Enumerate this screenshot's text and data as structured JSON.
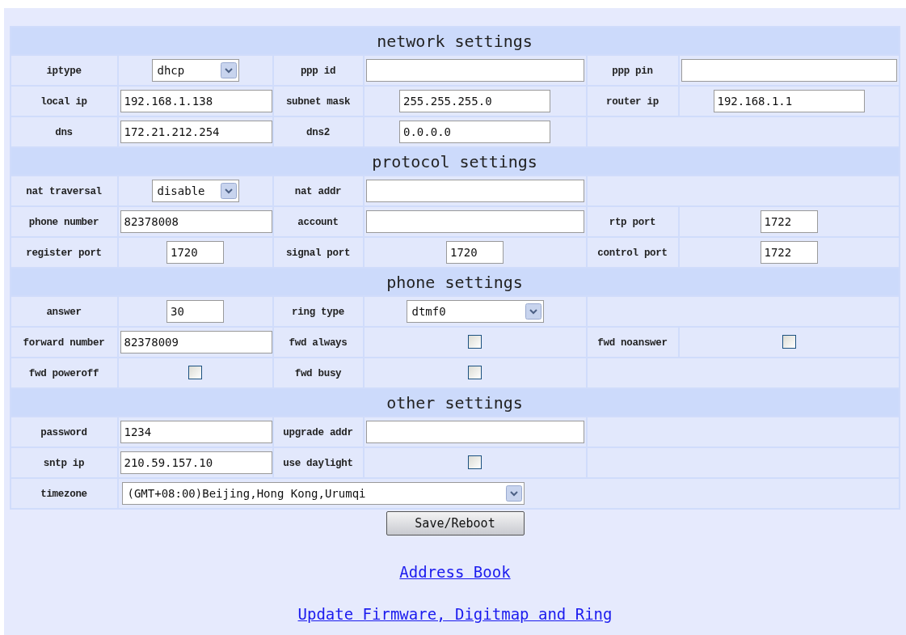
{
  "sections": [
    {
      "title": "network settings",
      "rows": [
        [
          {
            "kind": "label",
            "text": "iptype"
          },
          {
            "kind": "select",
            "value": "dhcp"
          },
          {
            "kind": "label",
            "text": "ppp id"
          },
          {
            "kind": "wide-field"
          },
          {
            "kind": "label",
            "text": "ppp pin"
          },
          {
            "kind": "wide-field"
          }
        ],
        [
          {
            "kind": "label",
            "text": "local ip"
          },
          {
            "kind": "wide-field",
            "value": "192.168.1.138"
          },
          {
            "kind": "label",
            "text": "subnet mask"
          },
          {
            "kind": "field",
            "value": "255.255.255.0"
          },
          {
            "kind": "label",
            "text": "router ip"
          },
          {
            "kind": "field",
            "value": "192.168.1.1"
          }
        ],
        [
          {
            "kind": "label",
            "text": "dns"
          },
          {
            "kind": "wide-field",
            "value": "172.21.212.254"
          },
          {
            "kind": "label",
            "text": "dns2"
          },
          {
            "kind": "field",
            "value": "0.0.0.0"
          },
          {
            "kind": "blank",
            "colspan": 2
          }
        ]
      ]
    },
    {
      "title": "protocol settings",
      "rows": [
        [
          {
            "kind": "label",
            "text": "nat traversal"
          },
          {
            "kind": "select",
            "value": "disable"
          },
          {
            "kind": "label",
            "text": "nat addr"
          },
          {
            "kind": "wide-field"
          },
          {
            "kind": "blank",
            "colspan": 2
          }
        ],
        [
          {
            "kind": "label",
            "text": "phone number"
          },
          {
            "kind": "wide-field",
            "value": "82378008"
          },
          {
            "kind": "label",
            "text": "account"
          },
          {
            "kind": "wide-field"
          },
          {
            "kind": "label",
            "text": "rtp port"
          },
          {
            "kind": "short-field",
            "value": "1722"
          }
        ],
        [
          {
            "kind": "label",
            "text": "register port"
          },
          {
            "kind": "short-field",
            "value": "1720"
          },
          {
            "kind": "label",
            "text": "signal port"
          },
          {
            "kind": "short-field",
            "value": "1720"
          },
          {
            "kind": "label",
            "text": "control port"
          },
          {
            "kind": "short-field",
            "value": "1722"
          }
        ]
      ]
    },
    {
      "title": "phone settings",
      "rows": [
        [
          {
            "kind": "label",
            "text": "answer"
          },
          {
            "kind": "short-field",
            "value": "30"
          },
          {
            "kind": "label",
            "text": "ring type"
          },
          {
            "kind": "wide-select",
            "value": "dtmf0"
          },
          {
            "kind": "blank",
            "colspan": 2
          }
        ],
        [
          {
            "kind": "label",
            "text": "forward number"
          },
          {
            "kind": "wide-field",
            "value": "82378009"
          },
          {
            "kind": "label",
            "text": "fwd always"
          },
          {
            "kind": "checkbox",
            "checked": false
          },
          {
            "kind": "label",
            "text": "fwd noanswer"
          },
          {
            "kind": "checkbox",
            "checked": false
          }
        ],
        [
          {
            "kind": "label",
            "text": "fwd poweroff"
          },
          {
            "kind": "checkbox",
            "checked": false
          },
          {
            "kind": "label",
            "text": "fwd busy"
          },
          {
            "kind": "checkbox",
            "checked": false
          },
          {
            "kind": "blank",
            "colspan": 2
          }
        ]
      ]
    },
    {
      "title": "other settings",
      "rows": [
        [
          {
            "kind": "label",
            "text": "password"
          },
          {
            "kind": "wide-field",
            "value": "1234"
          },
          {
            "kind": "label",
            "text": "upgrade addr"
          },
          {
            "kind": "wide-field"
          },
          {
            "kind": "blank",
            "colspan": 2
          }
        ],
        [
          {
            "kind": "label",
            "text": "sntp ip"
          },
          {
            "kind": "wide-field",
            "value": "210.59.157.10"
          },
          {
            "kind": "label",
            "text": "use daylight"
          },
          {
            "kind": "checkbox",
            "checked": false
          },
          {
            "kind": "blank",
            "colspan": 2
          }
        ],
        [
          {
            "kind": "label",
            "text": "timezone"
          },
          {
            "kind": "long-select",
            "value": "(GMT+08:00)Beijing,Hong Kong,Urumqi",
            "colspan": 5
          }
        ]
      ]
    }
  ],
  "save_button": "Save/Reboot",
  "links": [
    "Address Book",
    "Update Firmware, Digitmap and Ring"
  ]
}
